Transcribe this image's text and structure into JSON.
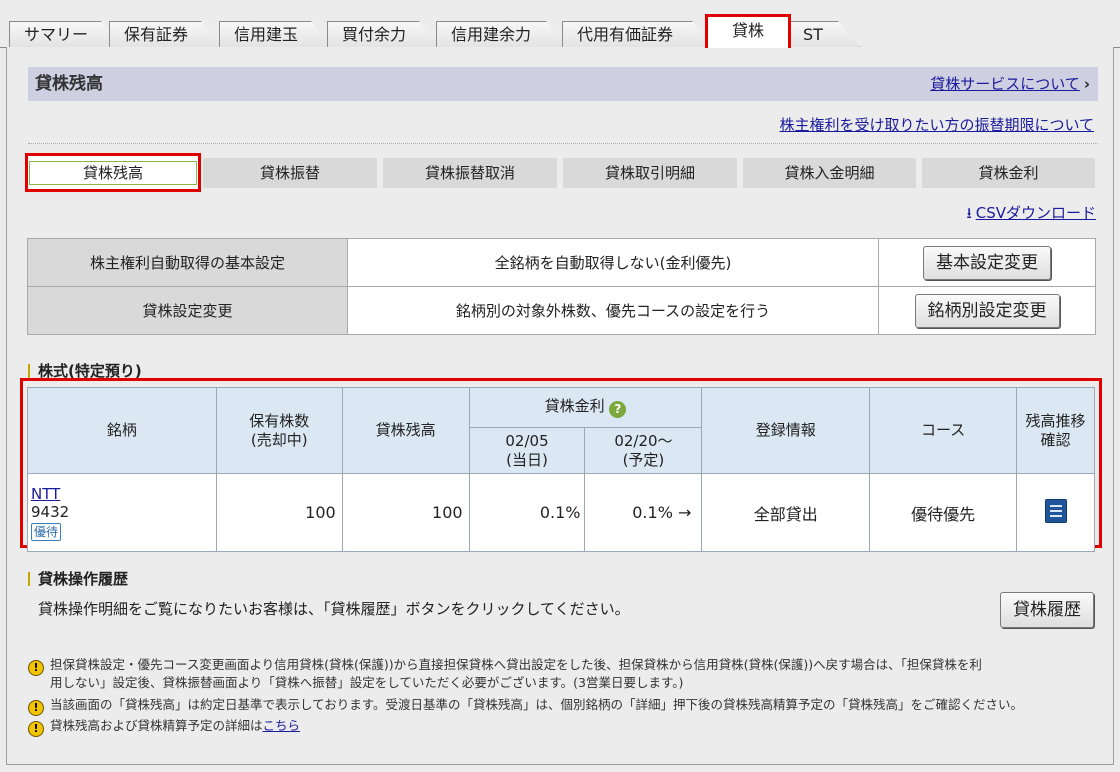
{
  "tabs": [
    {
      "label": "サマリー"
    },
    {
      "label": "保有証券"
    },
    {
      "label": "信用建玉"
    },
    {
      "label": "買付余力"
    },
    {
      "label": "信用建余力"
    },
    {
      "label": "代用有価証券"
    },
    {
      "label": "貸株"
    },
    {
      "label": "ST"
    }
  ],
  "section": {
    "title": "貸株残高",
    "service_link": "貸株サービスについて",
    "rights_link": "株主権利を受け取りたい方の振替期限について"
  },
  "subtabs": [
    {
      "label": "貸株残高"
    },
    {
      "label": "貸株振替"
    },
    {
      "label": "貸株振替取消"
    },
    {
      "label": "貸株取引明細"
    },
    {
      "label": "貸株入金明細"
    },
    {
      "label": "貸株金利"
    }
  ],
  "csv_link": "CSVダウンロード",
  "settings": [
    {
      "label": "株主権利自動取得の基本設定",
      "value": "全銘柄を自動取得しない(金利優先)",
      "button": "基本設定変更"
    },
    {
      "label": "貸株設定変更",
      "value": "銘柄別の対象外株数、優先コースの設定を行う",
      "button": "銘柄別設定変更"
    }
  ],
  "holdings": {
    "section_title": "株式(特定預り)",
    "headers": {
      "name": "銘柄",
      "shares_l1": "保有株数",
      "shares_l2": "(売却中)",
      "balance": "貸株残高",
      "rate": "貸株金利",
      "rate_today_l1": "02/05",
      "rate_today_l2": "(当日)",
      "rate_planned_l1": "02/20〜",
      "rate_planned_l2": "(予定)",
      "registration": "登録情報",
      "course": "コース",
      "history_l1": "残高推移",
      "history_l2": "確認"
    },
    "rows": [
      {
        "name": "NTT",
        "code": "9432",
        "badge": "優待",
        "shares": "100",
        "balance": "100",
        "rate_today": "0.1%",
        "rate_planned": "0.1% →",
        "registration": "全部貸出",
        "course": "優待優先"
      }
    ]
  },
  "history": {
    "title": "貸株操作履歴",
    "text": "貸株操作明細をご覧になりたいお客様は、「貸株履歴」ボタンをクリックしてください。",
    "button": "貸株履歴"
  },
  "notes": {
    "n1": "担保貸株設定・優先コース変更画面より信用貸株(貸株(保護))から直接担保貸株へ貸出設定をした後、担保貸株から信用貸株(貸株(保護))へ戻す場合は、「担保貸株を利",
    "n1b": "用しない」設定後、貸株振替画面より「貸株へ振替」設定をしていただく必要がございます。(3営業日要します。)",
    "n2": "当該画面の「貸株残高」は約定日基準で表示しております。受渡日基準の「貸株残高」は、個別銘柄の「詳細」押下後の貸株残高精算予定の「貸株残高」をご確認ください。",
    "n3": "貸株残高および貸株精算予定の詳細は",
    "n3_link": "こちら"
  }
}
